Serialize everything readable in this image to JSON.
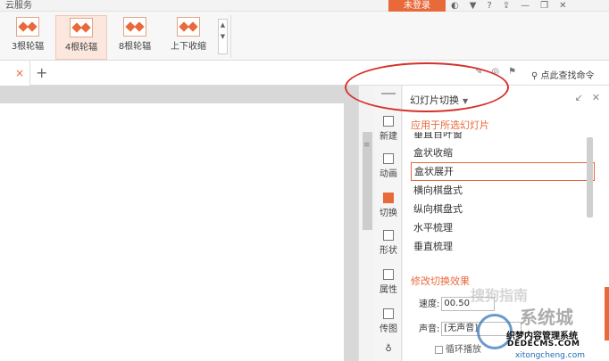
{
  "topbar": {
    "cloud_tab": "云服务",
    "login_label": "未登录",
    "icons": [
      "skin-icon",
      "shirt-icon",
      "help-icon",
      "upload-icon",
      "minimize-icon",
      "restore-icon",
      "close-icon"
    ]
  },
  "ribbon": {
    "effects": [
      {
        "label": "3根轮辐"
      },
      {
        "label": "4根轮辐"
      },
      {
        "label": "8根轮辐"
      },
      {
        "label": "上下收缩"
      }
    ]
  },
  "tabbar": {
    "add_label": "+",
    "close_label": "×",
    "find_command": "点此查找命令"
  },
  "rail": {
    "items": [
      {
        "label": "新建"
      },
      {
        "label": "动画"
      },
      {
        "label": "切换"
      },
      {
        "label": "形状"
      },
      {
        "label": "属性"
      },
      {
        "label": "传图"
      }
    ]
  },
  "panel": {
    "title": "幻灯片切换",
    "apply_section": "应用于所选幻灯片",
    "transitions": [
      "垂直百叶窗",
      "盒状收缩",
      "盒状展开",
      "横向棋盘式",
      "纵向棋盘式",
      "水平梳理",
      "垂直梳理"
    ],
    "selected_transition": "盒状展开",
    "modify_section": "修改切换效果",
    "speed_label": "速度:",
    "speed_value": "00.50",
    "sound_label": "声音:",
    "sound_value": "[无声音]",
    "loop_label": "循环播放"
  },
  "watermark": {
    "site_big": "系统城",
    "line1": "织梦内容管理系统",
    "line2": "DEDECMS.COM",
    "line3": "xitongcheng.com",
    "faded": "搜狗指南"
  },
  "colors": {
    "accent": "#e8693a",
    "annotation": "#d6302a"
  }
}
